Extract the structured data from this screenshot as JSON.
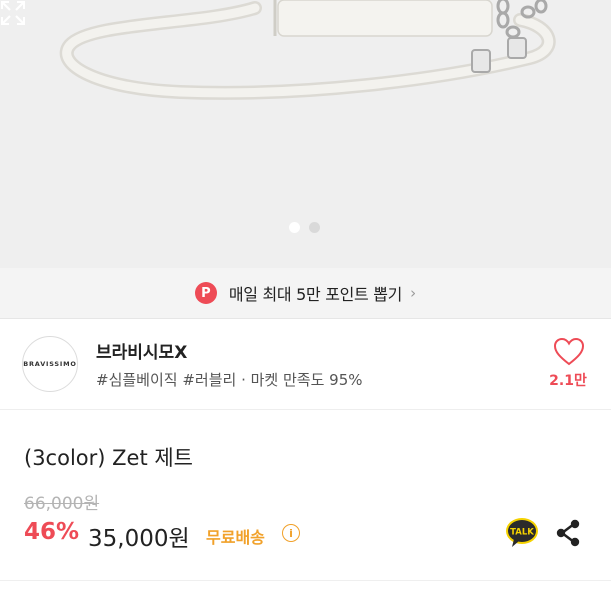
{
  "product_image": {
    "carousel_count": 2,
    "carousel_active_index": 0,
    "expand_icon": "expand-icon"
  },
  "point_banner": {
    "badge": "P",
    "text": "매일 최대 5만 포인트 뽑기",
    "chevron": "›"
  },
  "shop": {
    "logo_text": "BRAVISSIMO",
    "name": "브라비시모X",
    "tags": "#심플베이직 #러블리 · 마켓 만족도 95%",
    "like_count": "2.1만",
    "like_icon": "heart-icon"
  },
  "product": {
    "title": "(3color) Zet 제트",
    "original_price": "66,000원",
    "discount": "46%",
    "price": "35,000원",
    "shipping": "무료배송",
    "info_icon": "i",
    "talk_label": "TALK"
  },
  "colors": {
    "accent_red": "#ee4b56",
    "shipping_orange": "#f1a12a",
    "image_bg": "#efefef"
  }
}
